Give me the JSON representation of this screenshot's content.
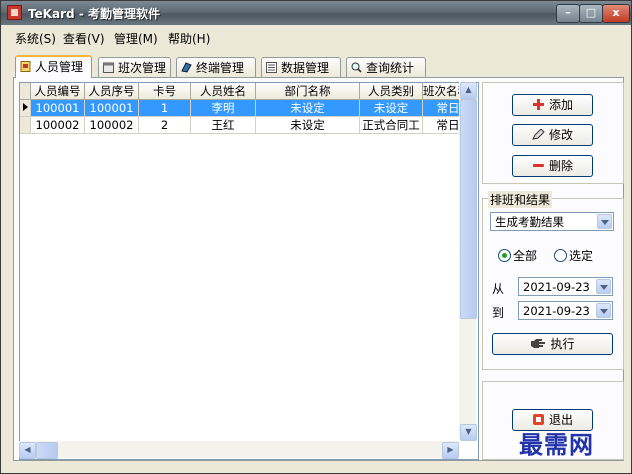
{
  "window": {
    "title": "TeKard - 考勤管理软件",
    "minimize": "–",
    "maximize": "□",
    "close": "x"
  },
  "menu": [
    "系统(S)",
    "查看(V)",
    "管理(M)",
    "帮助(H)"
  ],
  "tabs": [
    {
      "label": "人员管理",
      "icon": "person-card-icon",
      "active": true
    },
    {
      "label": "班次管理",
      "icon": "calendar-icon",
      "active": false
    },
    {
      "label": "终端管理",
      "icon": "terminal-icon",
      "active": false
    },
    {
      "label": "数据管理",
      "icon": "database-icon",
      "active": false
    },
    {
      "label": "查询统计",
      "icon": "magnifier-icon",
      "active": false
    }
  ],
  "table": {
    "columns": [
      "人员编号",
      "人员序号",
      "卡号",
      "人员姓名",
      "部门名称",
      "人员类别",
      "班次名称"
    ],
    "rows": [
      {
        "selected": true,
        "cells": [
          "100001",
          "100001",
          "1",
          "李明",
          "未设定",
          "未设定",
          "常日"
        ]
      },
      {
        "selected": false,
        "cells": [
          "100002",
          "100002",
          "2",
          "王红",
          "未设定",
          "正式合同工",
          "常日"
        ]
      }
    ]
  },
  "actions": {
    "add": "添加",
    "edit": "修改",
    "delete": "删除"
  },
  "schedule": {
    "group_label": "排班和结果",
    "mode_value": "生成考勤结果",
    "radio_all": "全部",
    "radio_selected": "选定",
    "selected_radio": "all",
    "from_label": "从",
    "to_label": "到",
    "from_date": "2021-09-23",
    "to_date": "2021-09-23",
    "execute": "执行"
  },
  "exit": "退出",
  "watermark": "最需网",
  "colors": {
    "selection": "#3399ff",
    "tab_highlight": "#f7b53b",
    "watermark": "#2233aa"
  }
}
